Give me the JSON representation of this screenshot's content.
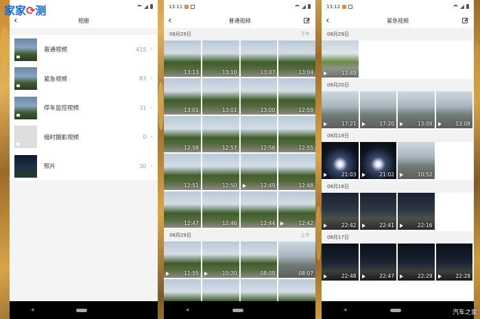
{
  "watermark": "家家",
  "watermark_tail": "测",
  "corner_mark": "汽车之家",
  "colors": {
    "accent": "#1a66c8",
    "navbar": "#000000",
    "section_bg": "#f2f2f2"
  },
  "phone1": {
    "title": "相册",
    "albums": [
      {
        "label": "普通视频",
        "count": "415",
        "thumb": "day"
      },
      {
        "label": "紧急视频",
        "count": "83",
        "thumb": "day"
      },
      {
        "label": "停车监控视频",
        "count": "31",
        "thumb": "day"
      },
      {
        "label": "缩时摄影视频",
        "count": "0",
        "thumb": "blank"
      },
      {
        "label": "照片",
        "count": "30",
        "thumb": "night"
      }
    ]
  },
  "phone2": {
    "status_time": "13:11",
    "title": "普通视频",
    "sections": [
      {
        "date": "08月29日",
        "ampm": "下午",
        "items": [
          {
            "t": "13:13",
            "f": false
          },
          {
            "t": "13:10",
            "f": false
          },
          {
            "t": "13:07",
            "f": false
          },
          {
            "t": "13:04",
            "f": false
          },
          {
            "t": "13:01",
            "f": false
          },
          {
            "t": "13:01",
            "f": false
          },
          {
            "t": "13:00",
            "f": false
          },
          {
            "t": "12:59",
            "f": false
          },
          {
            "t": "12:58",
            "f": false
          },
          {
            "t": "12:57",
            "f": false
          },
          {
            "t": "12:56",
            "f": false
          },
          {
            "t": "12:55",
            "f": false
          },
          {
            "t": "12:51",
            "f": false
          },
          {
            "t": "12:50",
            "f": false
          },
          {
            "t": "12:49",
            "f": true
          },
          {
            "t": "12:48",
            "f": false
          },
          {
            "t": "12:47",
            "f": false
          },
          {
            "t": "12:46",
            "f": false
          },
          {
            "t": "12:44",
            "f": false
          },
          {
            "t": "12:42",
            "f": true
          }
        ]
      },
      {
        "date": "08月29日",
        "ampm": "上午",
        "items": [
          {
            "t": "11:55",
            "f": true
          },
          {
            "t": "10:20",
            "f": true
          },
          {
            "t": "08:08",
            "f": false
          },
          {
            "t": "08:07",
            "f": false
          },
          {
            "t": "",
            "f": false
          },
          {
            "t": "",
            "f": false
          },
          {
            "t": "",
            "f": false
          },
          {
            "t": "",
            "f": false
          }
        ]
      }
    ]
  },
  "phone3": {
    "status_time": "13:12",
    "title": "紧急视频",
    "sections": [
      {
        "date": "08月29日",
        "items": [
          {
            "t": "12:49",
            "f": true,
            "c": "day"
          }
        ]
      },
      {
        "date": "08月20日",
        "items": [
          {
            "t": "17:21",
            "f": true,
            "c": "street"
          },
          {
            "t": "17:20",
            "f": true,
            "c": "street"
          },
          {
            "t": "13:09",
            "f": true,
            "c": "street"
          },
          {
            "t": "13:08",
            "f": true,
            "c": "street"
          }
        ]
      },
      {
        "date": "08月19日",
        "items": [
          {
            "t": "21:03",
            "f": true,
            "c": "night"
          },
          {
            "t": "21:02",
            "f": true,
            "c": "night"
          },
          {
            "t": "10:52",
            "f": true,
            "c": "street"
          }
        ]
      },
      {
        "date": "08月18日",
        "items": [
          {
            "t": "22:42",
            "f": true,
            "c": "dusk"
          },
          {
            "t": "22:41",
            "f": true,
            "c": "dusk"
          },
          {
            "t": "22:16",
            "f": true,
            "c": "dusk"
          }
        ]
      },
      {
        "date": "08月17日",
        "items": [
          {
            "t": "22:48",
            "f": true,
            "c": "nightc"
          },
          {
            "t": "22:47",
            "f": true,
            "c": "nightc"
          },
          {
            "t": "22:29",
            "f": true,
            "c": "nightc"
          },
          {
            "t": "22:28",
            "f": true,
            "c": "nightc"
          }
        ]
      }
    ]
  }
}
